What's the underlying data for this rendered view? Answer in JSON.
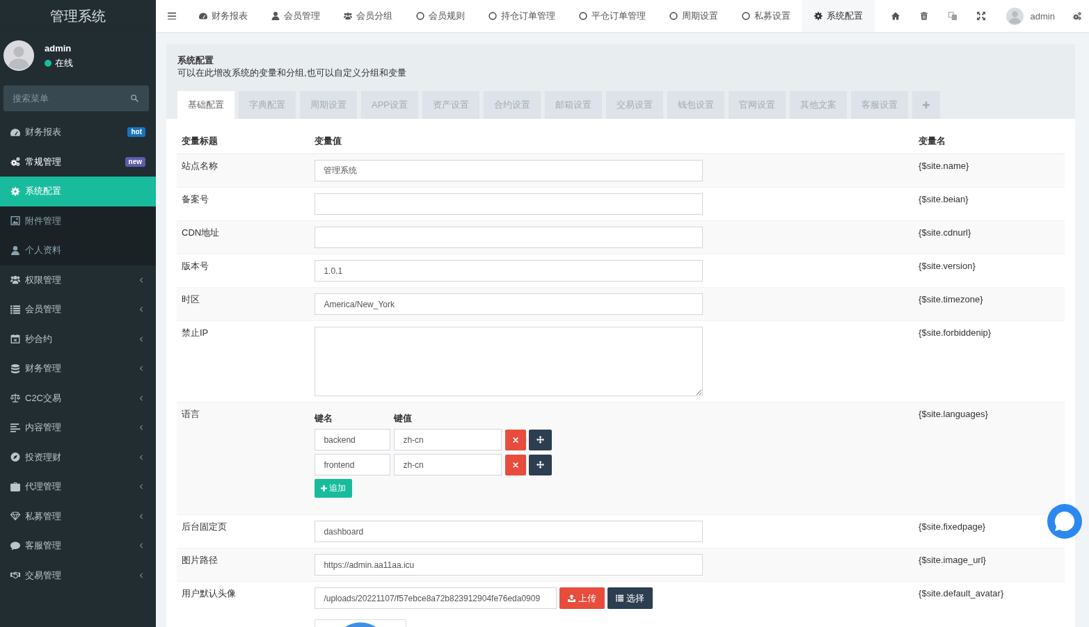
{
  "sidebar": {
    "logo": "管理系统",
    "user": {
      "name": "admin",
      "status": "在线",
      "online": true
    },
    "search": {
      "placeholder": "搜索菜单"
    },
    "menu": [
      {
        "label": "财务报表",
        "kind": "link",
        "selected": false,
        "badge": {
          "text": "hot",
          "color": "#1a73b8"
        }
      },
      {
        "label": "常规管理",
        "kind": "tree",
        "selected": false,
        "expanded": true,
        "badge": {
          "text": "new",
          "color": "#605ca8"
        },
        "children": [
          {
            "label": "系统配置",
            "selected": true
          },
          {
            "label": "附件管理",
            "selected": false
          },
          {
            "label": "个人资料",
            "selected": false
          }
        ]
      },
      {
        "label": "权限管理",
        "kind": "tree",
        "selected": false,
        "expanded": false
      },
      {
        "label": "会员管理",
        "kind": "tree",
        "selected": false,
        "expanded": false
      },
      {
        "label": "秒合约",
        "kind": "tree",
        "selected": false,
        "expanded": false
      },
      {
        "label": "财务管理",
        "kind": "tree",
        "selected": false,
        "expanded": false
      },
      {
        "label": "C2C交易",
        "kind": "tree",
        "selected": false,
        "expanded": false
      },
      {
        "label": "内容管理",
        "kind": "tree",
        "selected": false,
        "expanded": false
      },
      {
        "label": "投资理财",
        "kind": "tree",
        "selected": false,
        "expanded": false
      },
      {
        "label": "代理管理",
        "kind": "tree",
        "selected": false,
        "expanded": false
      },
      {
        "label": "私募管理",
        "kind": "tree",
        "selected": false,
        "expanded": false
      },
      {
        "label": "客服管理",
        "kind": "tree",
        "selected": false,
        "expanded": false
      },
      {
        "label": "交易管理",
        "kind": "tree",
        "selected": false,
        "expanded": false
      }
    ]
  },
  "navbar": {
    "tabs": [
      {
        "label": "财务报表",
        "selected": false
      },
      {
        "label": "会员管理",
        "selected": false
      },
      {
        "label": "会员分组",
        "selected": false
      },
      {
        "label": "会员规则",
        "selected": false
      },
      {
        "label": "持仓订单管理",
        "selected": false
      },
      {
        "label": "平仓订单管理",
        "selected": false
      },
      {
        "label": "周期设置",
        "selected": false
      },
      {
        "label": "私募设置",
        "selected": false
      },
      {
        "label": "系统配置",
        "selected": true
      }
    ],
    "user": {
      "name": "admin"
    }
  },
  "panel": {
    "title": "系统配置",
    "description": "可以在此增改系统的变量和分组,也可以自定义分组和变量",
    "tabs": [
      {
        "label": "基础配置",
        "selected": true
      },
      {
        "label": "字典配置",
        "selected": false
      },
      {
        "label": "周期设置",
        "selected": false
      },
      {
        "label": "APP设置",
        "selected": false
      },
      {
        "label": "资产设置",
        "selected": false
      },
      {
        "label": "合约设置",
        "selected": false
      },
      {
        "label": "邮箱设置",
        "selected": false
      },
      {
        "label": "交易设置",
        "selected": false
      },
      {
        "label": "钱包设置",
        "selected": false
      },
      {
        "label": "官网设置",
        "selected": false
      },
      {
        "label": "其他文案",
        "selected": false
      },
      {
        "label": "客服设置",
        "selected": false
      }
    ]
  },
  "table": {
    "columns": [
      "变量标题",
      "变量值",
      "变量名"
    ],
    "rows": [
      {
        "kind": "text",
        "label": "站点名称",
        "value": "管理系统",
        "variable": "{$site.name}"
      },
      {
        "kind": "text",
        "label": "备案号",
        "variable": "{$site.beian}"
      },
      {
        "kind": "text",
        "label": "CDN地址",
        "variable": "{$site.cdnurl}"
      },
      {
        "kind": "text",
        "label": "版本号",
        "value": "1.0.1",
        "variable": "{$site.version}"
      },
      {
        "kind": "text",
        "label": "时区",
        "value": "America/New_York",
        "variable": "{$site.timezone}"
      },
      {
        "kind": "textarea",
        "label": "禁止IP",
        "variable": "{$site.forbiddenip}"
      },
      {
        "kind": "array",
        "label": "语言",
        "headers": [
          "键名",
          "键值"
        ],
        "pairs": [
          {
            "key": "backend",
            "value": "zh-cn"
          },
          {
            "key": "frontend",
            "value": "zh-cn"
          }
        ],
        "add_label": "追加",
        "variable": "{$site.languages}"
      },
      {
        "kind": "text",
        "label": "后台固定页",
        "value": "dashboard",
        "variable": "{$site.fixedpage}"
      },
      {
        "kind": "text",
        "label": "图片路径",
        "value": "https://admin.aa11aa.icu",
        "variable": "{$site.image_url}"
      },
      {
        "kind": "image",
        "label": "用户默认头像",
        "value": "/uploads/20221107/f57ebce8a72b823912904fe76eda0909",
        "upload_label": "上传",
        "select_label": "选择",
        "variable": "{$site.default_avatar}"
      }
    ]
  }
}
